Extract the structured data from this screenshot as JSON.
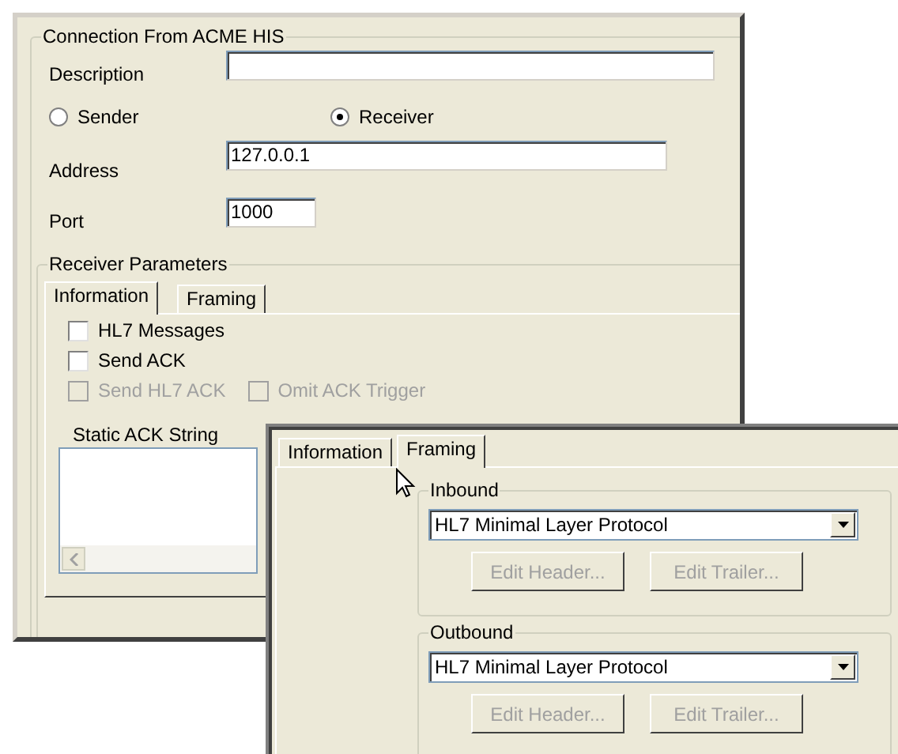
{
  "connection": {
    "title": "Connection From ACME HIS",
    "description": {
      "label": "Description"
    },
    "modes": [
      {
        "label": "Sender",
        "selected": false
      },
      {
        "label": "Receiver",
        "selected": true
      }
    ],
    "address": {
      "label": "Address",
      "value": "127.0.0.1"
    },
    "port": {
      "label": "Port",
      "value": "1000"
    }
  },
  "receiver_parameters": {
    "title": "Receiver Parameters",
    "tabs": [
      {
        "label": "Information",
        "selected": true
      },
      {
        "label": "Framing",
        "selected": false
      }
    ],
    "option_rows": [
      [
        {
          "label": "HL7 Messages",
          "checked": false,
          "disabled": false
        }
      ],
      [
        {
          "label": "Send ACK",
          "checked": false,
          "disabled": false
        }
      ],
      [
        {
          "label": "Send HL7 ACK",
          "checked": false,
          "disabled": true
        },
        {
          "label": "Omit ACK Trigger",
          "checked": false,
          "disabled": true
        }
      ]
    ],
    "static_ack": {
      "label": "Static ACK String"
    }
  },
  "framing_panel": {
    "tabs": [
      {
        "label": "Information",
        "selected": false
      },
      {
        "label": "Framing",
        "selected": true
      }
    ],
    "groups": [
      {
        "title": "Inbound",
        "protocol": "HL7 Minimal Layer Protocol",
        "buttons": [
          {
            "label": "Edit Header...",
            "disabled": true
          },
          {
            "label": "Edit Trailer...",
            "disabled": true
          }
        ]
      },
      {
        "title": "Outbound",
        "protocol": "HL7 Minimal Layer Protocol",
        "buttons": [
          {
            "label": "Edit Header...",
            "disabled": true
          },
          {
            "label": "Edit Trailer...",
            "disabled": true
          }
        ]
      }
    ]
  }
}
